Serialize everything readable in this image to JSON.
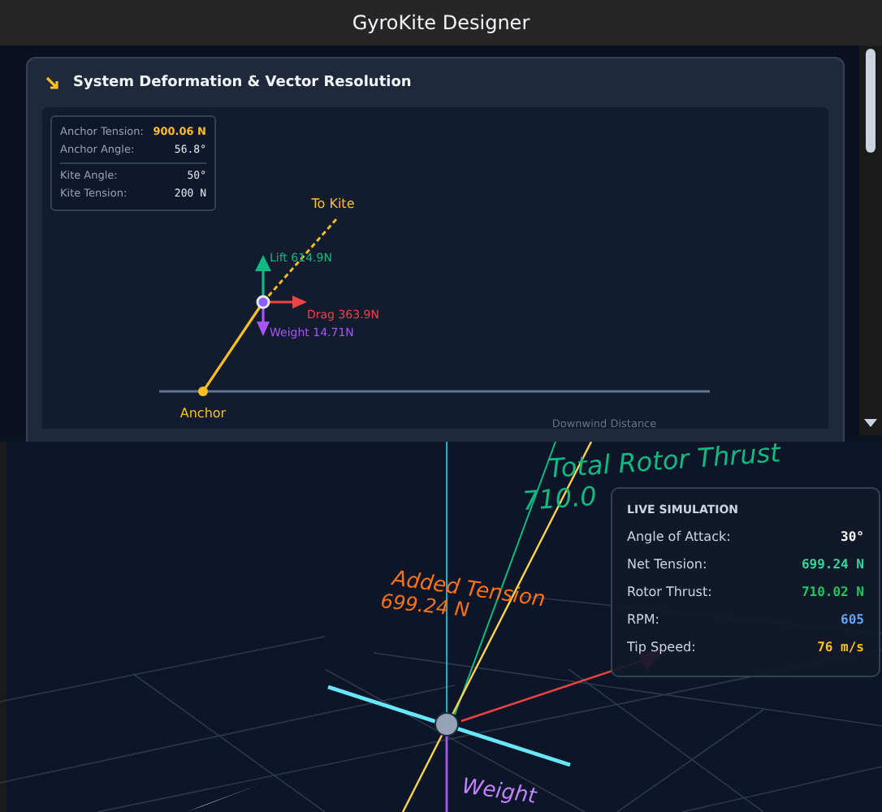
{
  "window": {
    "title": "GyroKite Designer"
  },
  "deformation_panel": {
    "title": "System Deformation & Vector Resolution",
    "readouts": [
      {
        "label": "Anchor Tension:",
        "value": "900.06 N",
        "kind": "highlight"
      },
      {
        "label": "Anchor Angle:",
        "value": "56.8°",
        "kind": "plain"
      },
      {
        "label": "Kite Angle:",
        "value": "50°",
        "kind": "plain"
      },
      {
        "label": "Kite Tension:",
        "value": "200 N",
        "kind": "plain"
      }
    ],
    "diagram": {
      "to_kite": "To Kite",
      "lift": "Lift 614.9N",
      "drag": "Drag 363.9N",
      "weight": "Weight 14.71N",
      "anchor": "Anchor",
      "axis_label": "Downwind Distance"
    }
  },
  "scene": {
    "labels": [
      {
        "text": "Total Rotor Thrust",
        "kind": "thrust"
      },
      {
        "text": "710.0",
        "kind": "thrust_value"
      },
      {
        "text": "Added Tension",
        "kind": "tension"
      },
      {
        "text": "699.24 N",
        "kind": "tension_value"
      },
      {
        "text": "Weight",
        "kind": "weight"
      }
    ]
  },
  "live_simulation": {
    "title": "LIVE SIMULATION",
    "rows": [
      {
        "label": "Angle of Attack:",
        "value": "30°",
        "color": "#ffffff"
      },
      {
        "label": "Net Tension:",
        "value": "699.24 N",
        "color": "#34d399"
      },
      {
        "label": "Rotor Thrust:",
        "value": "710.02 N",
        "color": "#22c55e"
      },
      {
        "label": "RPM:",
        "value": "605",
        "color": "#60a5fa"
      },
      {
        "label": "Tip Speed:",
        "value": "76 m/s",
        "color": "#fbbf24"
      }
    ]
  }
}
